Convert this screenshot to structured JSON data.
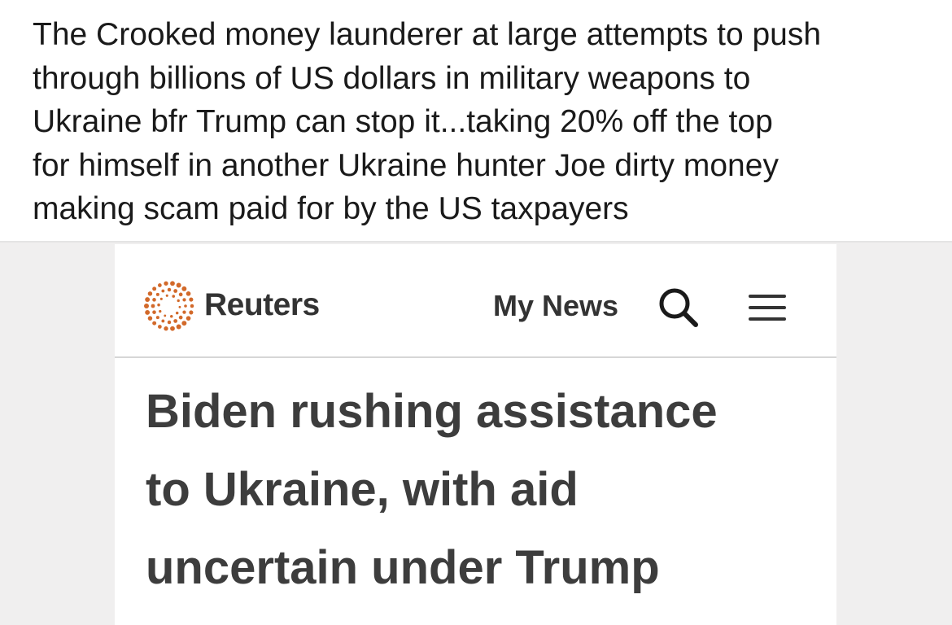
{
  "post": {
    "lines": [
      "The Crooked money launderer at large attempts to push",
      "through billions of US dollars in military weapons to",
      "Ukraine bfr Trump can stop it...taking 20% off the top",
      "for himself in another Ukraine hunter Joe dirty money",
      "making scam paid for by the US taxpayers"
    ]
  },
  "article": {
    "header": {
      "brand": "Reuters",
      "logo_icon": "reuters-dotted-circle-logo",
      "my_news_label": "My News",
      "search_icon": "search-icon",
      "menu_icon": "hamburger-menu-icon"
    },
    "headline_lines": [
      "Biden rushing assistance",
      "to Ukraine, with aid",
      "uncertain under Trump"
    ]
  },
  "colors": {
    "post_text": "#1a1a1a",
    "brand_orange": "#d2692a",
    "header_text": "#333333",
    "headline_text": "#3d3d3d",
    "image_background": "#f0efef"
  }
}
